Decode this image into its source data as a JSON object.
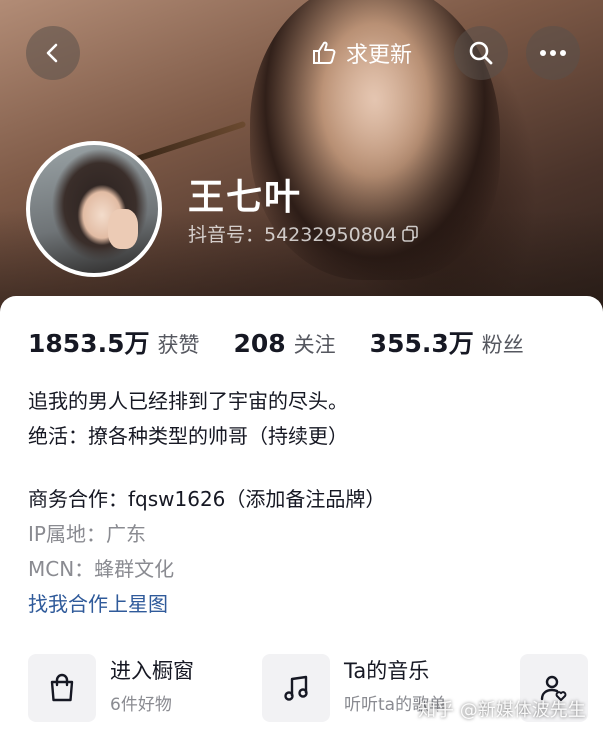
{
  "header": {
    "update_label": "求更新"
  },
  "profile": {
    "name": "王七叶",
    "douyin_id": "抖音号：54232950804"
  },
  "stats": [
    {
      "value": "1853.5万",
      "label": "获赞"
    },
    {
      "value": "208",
      "label": "关注"
    },
    {
      "value": "355.3万",
      "label": "粉丝"
    }
  ],
  "bio": {
    "line1": "追我的男人已经排到了宇宙的尽头。",
    "line2": "绝活：撩各种类型的帅哥（持续更）"
  },
  "business": "商务合作：fqsw1626（添加备注品牌）",
  "ip_location": "IP属地：广东",
  "mcn": "MCN：蜂群文化",
  "star_link": "找我合作上星图",
  "shortcuts": [
    {
      "title": "进入橱窗",
      "subtitle": "6件好物"
    },
    {
      "title": "Ta的音乐",
      "subtitle": "听听ta的歌单"
    }
  ],
  "watermark": "知乎 @新媒体波先生",
  "colors": {
    "link": "#2f5a9a",
    "muted": "#8a8b91",
    "text": "#161823"
  }
}
